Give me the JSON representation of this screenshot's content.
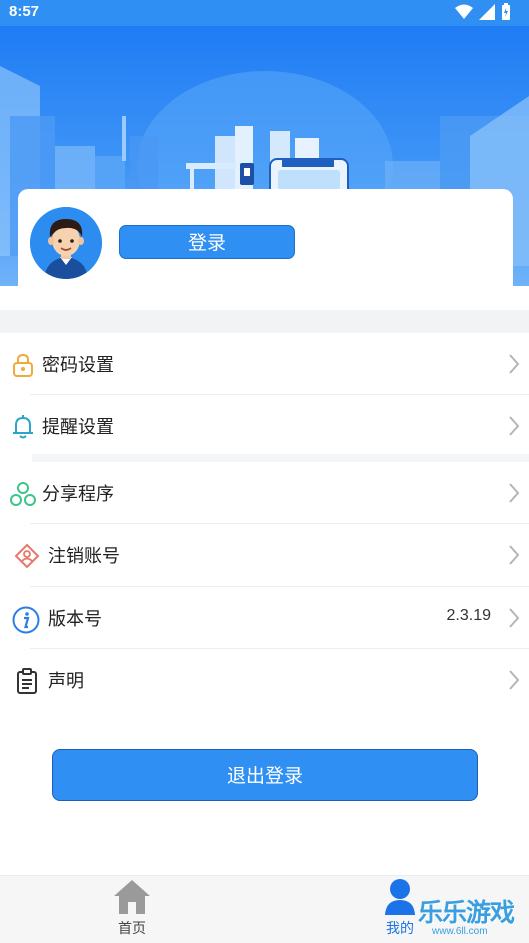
{
  "status_bar": {
    "time": "8:57"
  },
  "profile": {
    "login_label": "登录"
  },
  "menu": [
    {
      "label": "密码设置",
      "icon": "lock-icon"
    },
    {
      "label": "提醒设置",
      "icon": "bell-icon"
    },
    {
      "label": "分享程序",
      "icon": "share-icon"
    },
    {
      "label": "注销账号",
      "icon": "user-cancel-icon"
    },
    {
      "label": "版本号",
      "icon": "info-icon",
      "value": "2.3.19"
    },
    {
      "label": "声明",
      "icon": "clipboard-icon"
    }
  ],
  "logout_label": "退出登录",
  "bottom_nav": [
    {
      "label": "首页",
      "icon": "home-icon"
    },
    {
      "label": "我的",
      "icon": "person-icon"
    }
  ],
  "watermark": {
    "text": "乐乐游戏",
    "url": "www.6ll.com"
  },
  "colors": {
    "primary": "#2f8ff2",
    "header_top": "#1f7cf4",
    "divider": "#eeeeee"
  }
}
